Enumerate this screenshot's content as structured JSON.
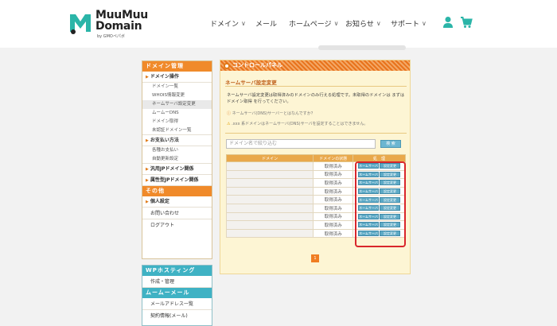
{
  "brand": {
    "name_line1": "MuuMuu",
    "name_line2": "Domain",
    "byline": "by GMOペパボ",
    "accent": "#2bb5a8"
  },
  "nav": {
    "items": [
      {
        "label": "ドメイン",
        "chevron": true
      },
      {
        "label": "メール",
        "chevron": false
      },
      {
        "label": "ホームページ",
        "chevron": true
      },
      {
        "label": "お知らせ",
        "chevron": true
      },
      {
        "label": "サポート",
        "chevron": true
      }
    ],
    "chevron_glyph": "∨",
    "user_icon": "user-icon",
    "cart_icon": "cart-icon"
  },
  "sidebar": {
    "domain_header": "ドメイン管理",
    "domain_ops": {
      "label": "ドメイン操作",
      "items": [
        "ドメイン一覧",
        "WHOIS情報変更",
        "ネームサーバ設定変更",
        "ムームーDNS",
        "ドメイン取得",
        "未認証ドメイン一覧"
      ],
      "active_index": 2
    },
    "payment": {
      "label": "お支払い方法",
      "items": [
        "各種お支払い",
        "自動更新設定"
      ]
    },
    "general_jp": "汎用JPドメイン関係",
    "regional_jp": "属性型JPドメイン関係",
    "other_header": "その他",
    "personal": "個人設定",
    "contact": "お問い合わせ",
    "logout": "ログアウト",
    "wp_header": "WPホスティング",
    "wp_create": "作成・管理",
    "mail_header": "ムームーメール",
    "mail_list": "メールアドレス一覧",
    "contract": "契約情報(メール)"
  },
  "panel": {
    "title": "コントロールパネル",
    "page_title": "ネームサーバ設定変更",
    "desc": "ネームサーバ設定変更は取得済みのドメインのみ行える処理です。未取得のドメインは まずは ドメイン取得 を行ってください。",
    "link_text": "ネームサーバ(DNS)サーバーとはなんですか？",
    "warn_text": ".xxx 系ドメインはネームサーバ(DNS)サーバを設定することはできません。",
    "search_placeholder": "ドメイン名で絞り込む",
    "search_button": "検 索",
    "table": {
      "headers": [
        "ドメイン",
        "ドメインの状態",
        "処　理"
      ],
      "status": "取得済み",
      "row_count": 9,
      "action_left": "ネームサーバ",
      "action_right": "設定変更"
    },
    "page_number": "1"
  },
  "colors": {
    "orange": "#f08a2a",
    "teal": "#3fb2c4",
    "highlight": "#d9262b"
  }
}
